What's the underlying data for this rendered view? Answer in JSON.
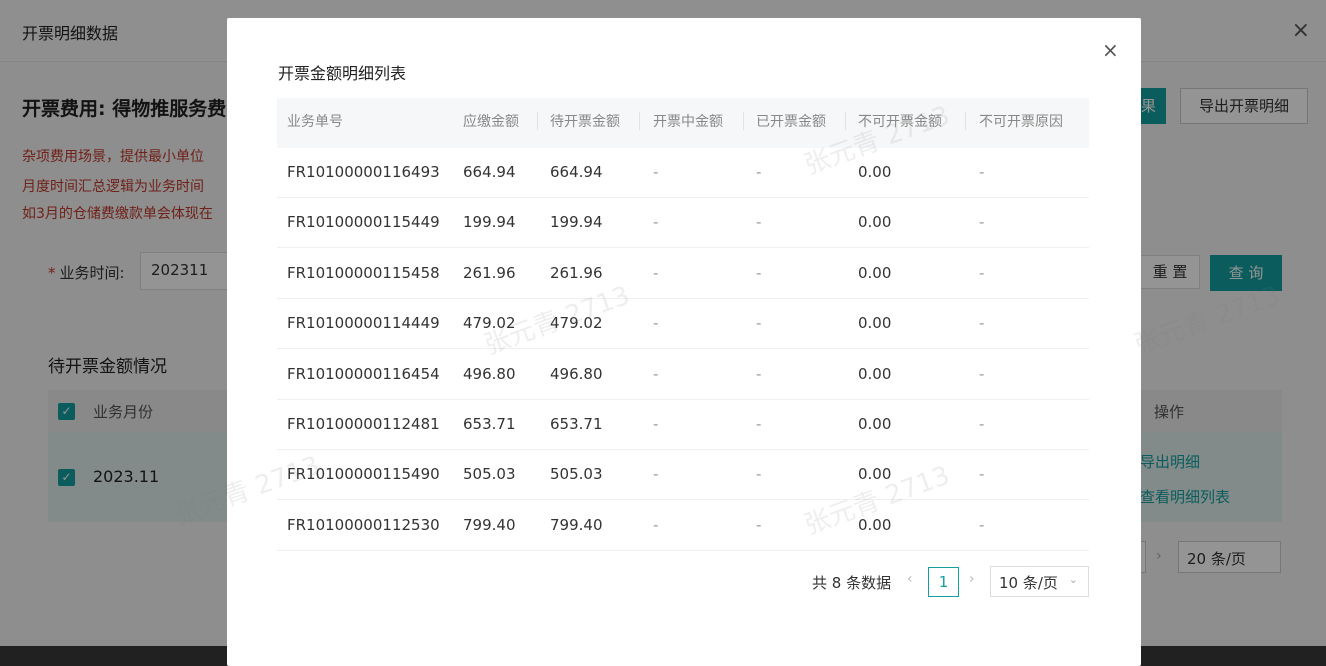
{
  "background": {
    "header_title": "开票明细数据",
    "close_icon": "×",
    "fee_title": "开票费用: 得物推服务费",
    "notes": [
      "杂项费用场景，提供最小单位",
      "月度时间汇总逻辑为业务时间",
      "如3月的仓储费缴款单会体现在"
    ],
    "business_time_label": "业务时间:",
    "business_time_value": "202311",
    "teal_button_fragment": "果",
    "export_button": "导出开票明细",
    "reset_button": "重 置",
    "query_button": "查 询",
    "section_title": "待开票金额情况",
    "table_header_month": "业务月份",
    "table_header_op": "操作",
    "row_month": "2023.11",
    "link_export": "导出明细",
    "link_view": "查看明细列表",
    "page_size": "20 条/页"
  },
  "modal": {
    "title": "开票金额明细列表",
    "close_icon": "×",
    "columns": [
      "业务单号",
      "应缴金额",
      "待开票金额",
      "开票中金额",
      "已开票金额",
      "不可开票金额",
      "不可开票原因"
    ],
    "rows": [
      [
        "FR10100000116493",
        "664.94",
        "664.94",
        "-",
        "-",
        "0.00",
        "-"
      ],
      [
        "FR10100000115449",
        "199.94",
        "199.94",
        "-",
        "-",
        "0.00",
        "-"
      ],
      [
        "FR10100000115458",
        "261.96",
        "261.96",
        "-",
        "-",
        "0.00",
        "-"
      ],
      [
        "FR10100000114449",
        "479.02",
        "479.02",
        "-",
        "-",
        "0.00",
        "-"
      ],
      [
        "FR10100000116454",
        "496.80",
        "496.80",
        "-",
        "-",
        "0.00",
        "-"
      ],
      [
        "FR10100000112481",
        "653.71",
        "653.71",
        "-",
        "-",
        "0.00",
        "-"
      ],
      [
        "FR10100000115490",
        "505.03",
        "505.03",
        "-",
        "-",
        "0.00",
        "-"
      ],
      [
        "FR10100000112530",
        "799.40",
        "799.40",
        "-",
        "-",
        "0.00",
        "-"
      ]
    ],
    "pagination": {
      "total": "共 8 条数据",
      "prev": "‹",
      "current_page": "1",
      "next": "›",
      "page_size": "10 条/页",
      "chevron": "⌄"
    }
  },
  "watermark": "张元青 2713",
  "colors": {
    "accent": "#14a0a0",
    "warning_text": "#c0392b"
  }
}
